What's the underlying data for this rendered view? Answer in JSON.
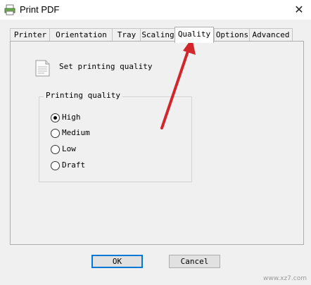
{
  "window": {
    "title": "Print PDF",
    "close_glyph": "✕"
  },
  "tabs": [
    {
      "label": "Printer"
    },
    {
      "label": "Orientation"
    },
    {
      "label": "Tray"
    },
    {
      "label": "Scaling"
    },
    {
      "label": "Quality"
    },
    {
      "label": "Options"
    },
    {
      "label": "Advanced"
    }
  ],
  "active_tab": "Quality",
  "panel": {
    "header_text": "Set printing quality",
    "header_icon": "document-icon",
    "group_title": "Printing quality",
    "options": [
      {
        "label": "High",
        "checked": true
      },
      {
        "label": "Medium",
        "checked": false
      },
      {
        "label": "Low",
        "checked": false
      },
      {
        "label": "Draft",
        "checked": false
      }
    ]
  },
  "buttons": {
    "ok": "OK",
    "cancel": "Cancel"
  },
  "watermark": "www.xz7.com",
  "colors": {
    "accent": "#0078d7",
    "annotation_arrow": "#d0262c"
  }
}
